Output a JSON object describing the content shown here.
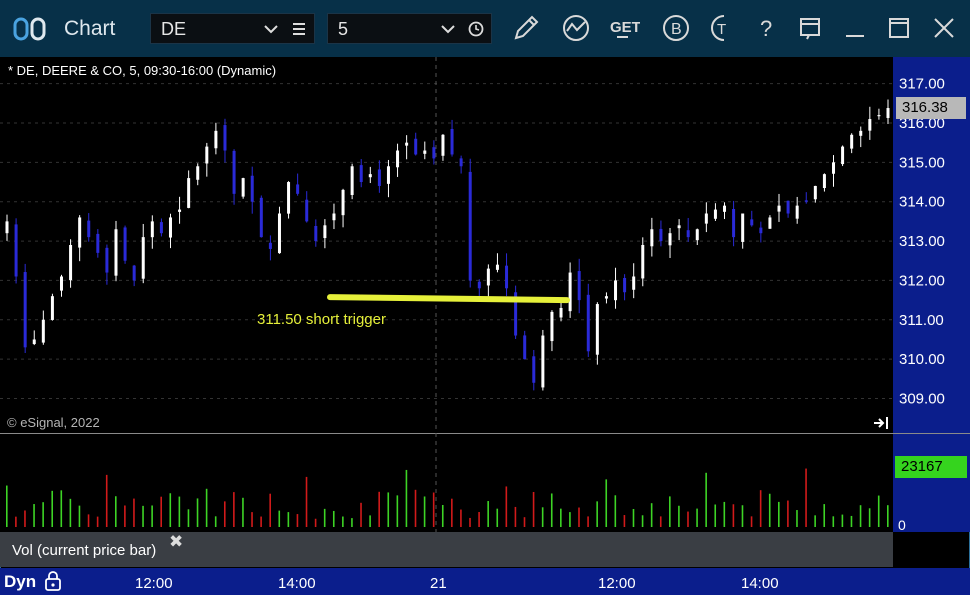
{
  "window": {
    "title": "Chart",
    "symbol_value": "DE",
    "interval_value": "5"
  },
  "toolbar": {
    "icons": [
      "link-icon",
      "list-icon",
      "clock-icon",
      "pencil-icon",
      "study-icon",
      "get-icon",
      "b-icon",
      "t-icon",
      "help-icon",
      "template-icon",
      "minimize-icon",
      "maximize-icon",
      "close-icon"
    ],
    "get_label": "GET",
    "b_label": "B",
    "t_label": "T",
    "help_label": "?"
  },
  "chart_header": {
    "legend": "* DE, DEERE & CO, 5, 09:30-16:00 (Dynamic)",
    "copyright": "© eSignal, 2022"
  },
  "annotation": {
    "text": "311.50 short trigger",
    "level": 311.5,
    "color": "#e6f03a"
  },
  "price_tag": "316.38",
  "volume_panel": {
    "label": "Vol (current price bar)",
    "current_value": "23167",
    "zero_label": "0"
  },
  "bottom_bar": {
    "mode": "Dyn",
    "time_labels": [
      "12:00",
      "14:00",
      "21",
      "12:00",
      "14:00"
    ]
  },
  "colors": {
    "up_candle": "#ffffff",
    "down_candle": "#2a2ad8",
    "vol_up": "#3dd425",
    "vol_down": "#d21a1a",
    "price_axis_bg": "#0b1e8c",
    "title_bg": "#073048"
  },
  "chart_data": {
    "type": "candlestick",
    "title": "DE, DEERE & CO, 5, 09:30-16:00 (Dynamic)",
    "y_ticks": [
      "317.00",
      "316.00",
      "315.00",
      "314.00",
      "313.00",
      "312.00",
      "311.00",
      "310.00",
      "309.00"
    ],
    "ylim": [
      308.2,
      317.6
    ],
    "x_ticks": [
      "12:00",
      "14:00",
      "21",
      "12:00",
      "14:00"
    ],
    "last_price": 316.38,
    "last_volume": 23167,
    "grid": true,
    "closes": [
      313.5,
      312.1,
      310.3,
      310.5,
      311.0,
      311.6,
      312.1,
      312.9,
      313.6,
      313.1,
      312.7,
      312.2,
      313.3,
      312.5,
      312.0,
      313.1,
      313.5,
      313.2,
      313.6,
      313.8,
      314.6,
      314.9,
      315.4,
      315.8,
      315.3,
      314.2,
      314.6,
      314.0,
      313.1,
      312.8,
      313.7,
      314.5,
      314.2,
      313.5,
      313.0,
      313.4,
      313.7,
      314.3,
      314.9,
      314.5,
      314.7,
      314.4,
      314.9,
      315.3,
      315.5,
      315.2,
      315.3,
      315.1,
      315.7,
      315.2,
      314.9,
      312.0,
      311.8,
      312.3,
      312.4,
      311.8,
      310.6,
      310.0,
      309.4,
      310.6,
      311.2,
      311.3,
      312.2,
      311.5,
      310.2,
      311.4,
      311.6,
      312.0,
      311.7,
      312.1,
      312.9,
      313.3,
      313.0,
      313.2,
      313.4,
      313.1,
      313.3,
      313.7,
      313.8,
      313.9,
      313.1,
      313.7,
      313.4,
      313.2,
      313.6,
      313.9,
      313.7,
      313.9,
      314.0,
      314.4,
      314.7,
      315.0,
      315.4,
      315.7,
      315.8,
      316.1,
      316.2,
      316.38
    ]
  }
}
